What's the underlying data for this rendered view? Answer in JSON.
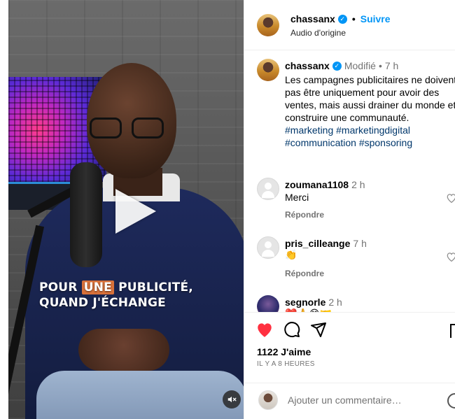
{
  "video": {
    "caption_line1_pre": "POUR ",
    "caption_line1_hl": "UNE",
    "caption_line1_post": " PUBLICITÉ,",
    "caption_line2": "QUAND J'ÉCHANGE",
    "play_icon": "play-icon",
    "mute_icon": "speaker-muted-icon"
  },
  "header": {
    "username": "chassanx",
    "verified": "✓",
    "separator": "•",
    "follow_label": "Suivre",
    "audio": "Audio d'origine"
  },
  "post": {
    "username": "chassanx",
    "verified": "✓",
    "edited": "Modifié",
    "separator": "•",
    "time": "7 h",
    "text": "Les campagnes publicitaires ne doivent pas être uniquement pour avoir des ventes, mais aussi drainer du monde et construire une communauté.",
    "hashtags": "#marketing #marketingdigital #communication #sponsoring"
  },
  "comments": [
    {
      "username": "zoumana1108",
      "time": "2 h",
      "text": "Merci",
      "reply": "Répondre"
    },
    {
      "username": "pris_cilleange",
      "time": "7 h",
      "text": "👏",
      "reply": "Répondre"
    },
    {
      "username": "segnorle",
      "time": "2 h",
      "text": "❤️🙏😊🤝"
    }
  ],
  "actions": {
    "likes": "1122 J'aime",
    "time_ago": "IL Y A 8 HEURES",
    "comment_placeholder": "Ajouter un commentaire…"
  },
  "colors": {
    "accent": "#0095f6",
    "like_red": "#ff3040",
    "caption_highlight": "#d8713a"
  }
}
